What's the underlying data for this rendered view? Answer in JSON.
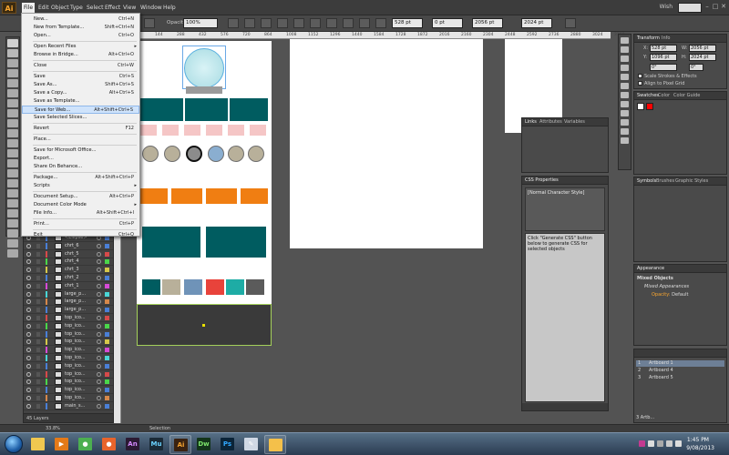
{
  "app": {
    "logo": "Ai",
    "accent": "#f7a530",
    "workspace": "Wish"
  },
  "menubar": {
    "items": [
      "File",
      "Edit",
      "Object",
      "Type",
      "Select",
      "Effect",
      "View",
      "Window",
      "Help"
    ]
  },
  "controlbar": {
    "opacity_label": "Opacity",
    "opacity_value": "100%",
    "x_value": "528 pt",
    "y_value": "0 pt",
    "w_value": "2056 pt",
    "h_value": "2024 pt"
  },
  "file_menu": {
    "items": [
      {
        "label": "New...",
        "shortcut": "Ctrl+N"
      },
      {
        "label": "New from Template...",
        "shortcut": "Shift+Ctrl+N"
      },
      {
        "label": "Open...",
        "shortcut": "Ctrl+O"
      },
      {
        "label": "Open Recent Files",
        "shortcut": "",
        "submenu": true
      },
      {
        "label": "Browse in Bridge...",
        "shortcut": "Alt+Ctrl+O"
      },
      {
        "label": "Close",
        "shortcut": "Ctrl+W"
      },
      {
        "label": "Save",
        "shortcut": "Ctrl+S"
      },
      {
        "label": "Save As...",
        "shortcut": "Shift+Ctrl+S"
      },
      {
        "label": "Save a Copy...",
        "shortcut": "Alt+Ctrl+S"
      },
      {
        "label": "Save as Template...",
        "shortcut": ""
      },
      {
        "label": "Save for Web...",
        "shortcut": "Alt+Shift+Ctrl+S",
        "highlighted": true
      },
      {
        "label": "Save Selected Slices...",
        "shortcut": ""
      },
      {
        "label": "Revert",
        "shortcut": "F12"
      },
      {
        "label": "Place...",
        "shortcut": ""
      },
      {
        "label": "Save for Microsoft Office...",
        "shortcut": ""
      },
      {
        "label": "Export...",
        "shortcut": ""
      },
      {
        "label": "Share On Behance...",
        "shortcut": ""
      },
      {
        "label": "Package...",
        "shortcut": "Alt+Shift+Ctrl+P"
      },
      {
        "label": "Scripts",
        "shortcut": "",
        "submenu": true
      },
      {
        "label": "Document Setup...",
        "shortcut": "Alt+Ctrl+P"
      },
      {
        "label": "Document Color Mode",
        "shortcut": "",
        "submenu": true
      },
      {
        "label": "File Info...",
        "shortcut": "Alt+Shift+Ctrl+I"
      },
      {
        "label": "Print...",
        "shortcut": "Ctrl+P"
      },
      {
        "label": "Exit",
        "shortcut": "Ctrl+Q"
      }
    ]
  },
  "ruler": {
    "ticks": [
      "144",
      "288",
      "432",
      "576",
      "720",
      "864",
      "1008",
      "1152",
      "1296",
      "1440",
      "1584",
      "1728",
      "1872",
      "2016",
      "2160",
      "2304",
      "2448",
      "2592",
      "2736",
      "2880",
      "3024",
      "3168"
    ]
  },
  "layers_panel": {
    "rows": [
      {
        "name": "<Ellipse>",
        "color": "#4a7fd6"
      },
      {
        "name": "chrt_6",
        "color": "#4a7fd6"
      },
      {
        "name": "chrt_5",
        "color": "#d64a4a"
      },
      {
        "name": "chrt_4",
        "color": "#4ad64a"
      },
      {
        "name": "chrt_3",
        "color": "#d6c84a"
      },
      {
        "name": "chrt_2",
        "color": "#4a7fd6"
      },
      {
        "name": "chrt_1",
        "color": "#d64ad6"
      },
      {
        "name": "large_p...",
        "color": "#4ad6d6"
      },
      {
        "name": "large_p...",
        "color": "#d6884a"
      },
      {
        "name": "large_p...",
        "color": "#4a7fd6"
      },
      {
        "name": "top_ico...",
        "color": "#d64a4a"
      },
      {
        "name": "top_ico...",
        "color": "#4ad64a"
      },
      {
        "name": "top_ico...",
        "color": "#4a7fd6"
      },
      {
        "name": "top_ico...",
        "color": "#d6c84a"
      },
      {
        "name": "top_ico...",
        "color": "#d64ad6"
      },
      {
        "name": "top_ico...",
        "color": "#4ad6d6"
      },
      {
        "name": "top_ico...",
        "color": "#4a7fd6"
      },
      {
        "name": "top_ico...",
        "color": "#d64a4a"
      },
      {
        "name": "top_ico...",
        "color": "#4ad64a"
      },
      {
        "name": "top_ico...",
        "color": "#4a7fd6"
      },
      {
        "name": "top_ico...",
        "color": "#d6884a"
      },
      {
        "name": "main_s...",
        "color": "#4a7fd6"
      }
    ],
    "footer": "45 Layers"
  },
  "links_panel": {
    "tabs": [
      "Links",
      "Attributes",
      "Variables"
    ]
  },
  "css_panel": {
    "title": "CSS Properties",
    "list_item": "[Normal Character Style]",
    "message": "Click \"Generate CSS\" button below to generate CSS for selected objects"
  },
  "transform_panel": {
    "tabs": [
      "Transform",
      "Info"
    ],
    "x": "528 pt",
    "y": "1096 pt",
    "w": "2056 pt",
    "h": "2024 pt",
    "angle": "0°",
    "shear": "0°",
    "scale_strokes": "Scale Strokes & Effects",
    "align_pixel": "Align to Pixel Grid"
  },
  "swatches_panel": {
    "tabs": [
      "Swatches",
      "Color",
      "Color Guide"
    ]
  },
  "symbols_panel": {
    "tabs": [
      "Symbols",
      "Brushes",
      "Graphic Styles"
    ]
  },
  "appearance_panel": {
    "title": "Appearance",
    "mixed_objects": "Mixed Objects",
    "mixed_appearances": "Mixed Appearances",
    "opacity_label": "Opacity:",
    "opacity_value": "Default"
  },
  "artboards_panel": {
    "items": [
      {
        "num": "1",
        "name": "Artboard 1"
      },
      {
        "num": "2",
        "name": "Artboard 4"
      },
      {
        "num": "3",
        "name": "Artboard 5"
      }
    ],
    "footer": "3 Artb..."
  },
  "statusbar": {
    "zoom": "33.8%",
    "tool": "Selection"
  },
  "taskbar": {
    "apps": [
      {
        "name": "explorer",
        "color": "#f0c850",
        "glyph": ""
      },
      {
        "name": "media-player",
        "color": "#e47a18",
        "glyph": "▶"
      },
      {
        "name": "chrome",
        "color": "#4caf50",
        "glyph": "●"
      },
      {
        "name": "firefox",
        "color": "#e8642b",
        "glyph": "●"
      },
      {
        "name": "animate",
        "color": "#2b1a33",
        "glyph": "An"
      },
      {
        "name": "muse",
        "color": "#1a2a36",
        "glyph": "Mu"
      },
      {
        "name": "illustrator",
        "color": "#3a2210",
        "glyph": "Ai"
      },
      {
        "name": "dreamweaver",
        "color": "#13351a",
        "glyph": "Dw"
      },
      {
        "name": "photoshop",
        "color": "#0b2438",
        "glyph": "Ps"
      },
      {
        "name": "paint",
        "color": "#d0d8e4",
        "glyph": "✎"
      },
      {
        "name": "folder",
        "color": "#f4c04a",
        "glyph": ""
      }
    ],
    "time": "1:45 PM",
    "date": "9/08/2013"
  }
}
